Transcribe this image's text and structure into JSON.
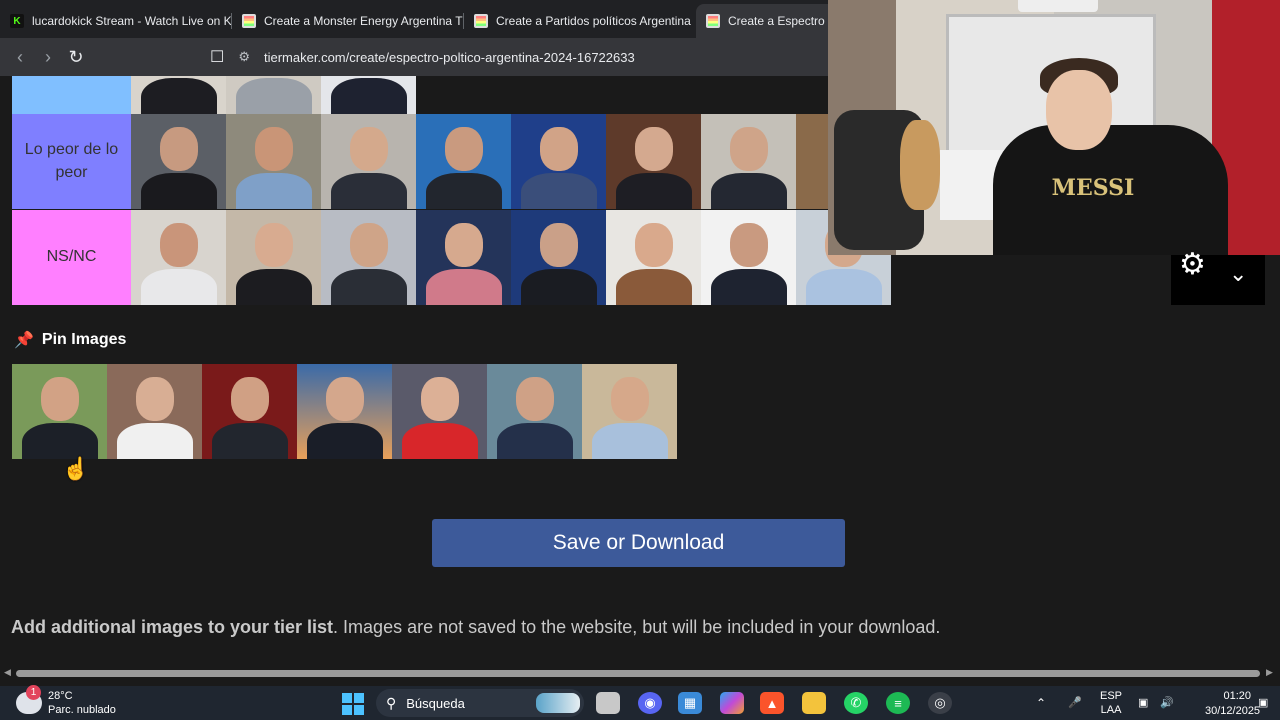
{
  "tabs": [
    {
      "label": "lucardokick Stream - Watch Live on K",
      "favicon": "kick-icon",
      "active": false
    },
    {
      "label": "Create a Monster Energy Argentina T",
      "favicon": "tiermaker-icon",
      "active": false
    },
    {
      "label": "Create a Partidos políticos Argentina",
      "favicon": "tiermaker-icon",
      "active": false
    },
    {
      "label": "Create a Espectro p",
      "favicon": "tiermaker-icon",
      "active": true
    }
  ],
  "address": {
    "url": "tiermaker.com/create/espectro-poltico-argentina-2024-16722633"
  },
  "tiers": [
    {
      "label": "",
      "color": "#80bfff",
      "items": 3
    },
    {
      "label": "Lo peor de lo peor",
      "color": "#7f7fff",
      "items": 8
    },
    {
      "label": "NS/NC",
      "color": "#ff7fff",
      "items": 8
    }
  ],
  "pin_section": {
    "title": "Pin Images",
    "items": 7
  },
  "save_button": {
    "label": "Save or Download"
  },
  "add_images": {
    "bold": "Add additional images to your tier list",
    "rest": ". Images are not saved to the website, but will be included in your download."
  },
  "webcam": {
    "shirt_text": "MESSI"
  },
  "taskbar": {
    "weather_temp": "28°C",
    "weather_desc": "Parc. nublado",
    "search_placeholder": "Búsqueda",
    "lang_top": "ESP",
    "lang_bottom": "LAA",
    "time": "01:20",
    "date": "30/12/2025"
  },
  "colors": {
    "accent_button": "#3d5a9a",
    "page_bg": "#1a1a1a"
  }
}
